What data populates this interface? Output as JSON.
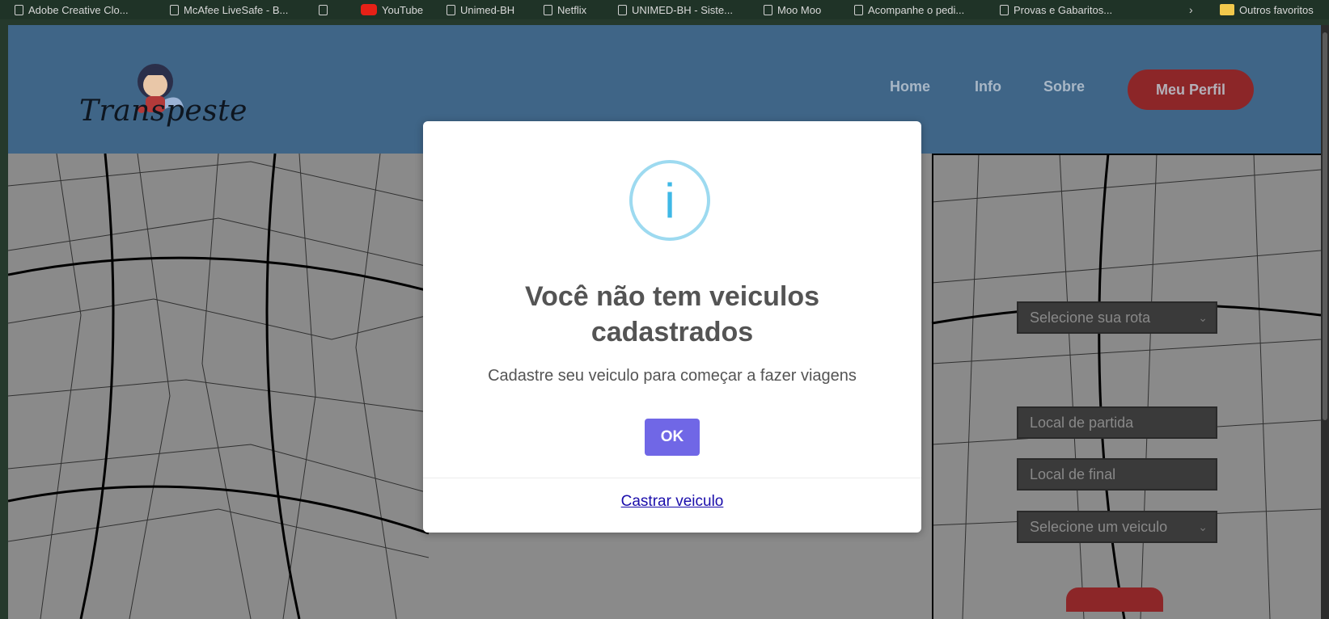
{
  "bookmarks": [
    {
      "label": "Adobe Creative Clo...",
      "icon": "page-icon"
    },
    {
      "label": "McAfee LiveSafe - B...",
      "icon": "page-icon"
    },
    {
      "label": "",
      "icon": "page-icon"
    },
    {
      "label": "YouTube",
      "icon": "youtube-icon"
    },
    {
      "label": "Unimed-BH",
      "icon": "page-icon"
    },
    {
      "label": "Netflix",
      "icon": "page-icon"
    },
    {
      "label": "UNIMED-BH - Siste...",
      "icon": "page-icon"
    },
    {
      "label": "Moo Moo",
      "icon": "page-icon"
    },
    {
      "label": "Acompanhe o pedi...",
      "icon": "page-icon"
    },
    {
      "label": "Provas e Gabaritos...",
      "icon": "page-icon"
    }
  ],
  "bookmarks_more": "›",
  "other_favorites": "Outros favoritos",
  "header": {
    "logo_text": "Transpeste",
    "nav": [
      "Home",
      "Info",
      "Sobre"
    ],
    "profile_label": "Meu Perfil"
  },
  "side": {
    "route_select": "Selecione sua rota",
    "start_input": "Local de partida",
    "end_input": "Local de final",
    "vehicle_select": "Selecione um veiculo"
  },
  "modal": {
    "icon": "info-icon",
    "icon_glyph": "i",
    "title": "Você não tem veiculos cadastrados",
    "text": "Cadastre seu veiculo para começar a fazer viagens",
    "ok_label": "OK",
    "link_label": "Castrar veiculo"
  },
  "colors": {
    "header_bg": "#3f6587",
    "profile_button": "#8c2628",
    "ok_button": "#7067e6",
    "info_icon": "#3fb8e6",
    "link": "#1a0dab"
  }
}
